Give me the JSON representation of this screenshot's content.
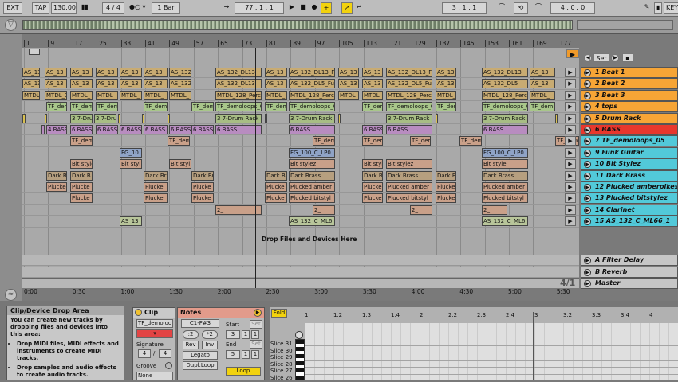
{
  "transport": {
    "ext": "EXT",
    "tap": "TAP",
    "tempo": "130.00",
    "signature": "4 / 4",
    "quantize": "1 Bar",
    "position": "77 . 1 . 1",
    "loop_start": "3 . 1 . 1",
    "loop_length": "4 . 0 . 0",
    "key": "KEY"
  },
  "ruler": {
    "bars": [
      "1",
      "9",
      "17",
      "25",
      "33",
      "41",
      "49",
      "57",
      "65",
      "73",
      "81",
      "89",
      "97",
      "105",
      "113",
      "121",
      "129",
      "137",
      "145",
      "153",
      "161",
      "169",
      "177"
    ]
  },
  "time_ruler": {
    "labels": [
      "0:00",
      "0:30",
      "1:00",
      "1:30",
      "2:00",
      "2:30",
      "3:00",
      "3:30",
      "4:00",
      "4:30",
      "5:00",
      "5:30"
    ]
  },
  "arrangement": {
    "drop_text": "Drop Files and Devices Here",
    "ratio": "4/1",
    "set_label": "Set"
  },
  "tracks": [
    {
      "name": "1 Beat 1",
      "color": "#f7a536"
    },
    {
      "name": "2 Beat 2",
      "color": "#f7a536"
    },
    {
      "name": "3 Beat 3",
      "color": "#f7a536"
    },
    {
      "name": "4 tops",
      "color": "#f7a536"
    },
    {
      "name": "5 Drum Rack",
      "color": "#f7a536"
    },
    {
      "name": "6 BASS",
      "color": "#e8372d"
    },
    {
      "name": "7 TF_demoloops_05",
      "color": "#52c9d9"
    },
    {
      "name": "9 Funk Guitar",
      "color": "#52c9d9"
    },
    {
      "name": "10 Bit Stylez",
      "color": "#52c9d9"
    },
    {
      "name": "11 Dark Brass",
      "color": "#52c9d9"
    },
    {
      "name": "12 Plucked amberpikes",
      "color": "#52c9d9"
    },
    {
      "name": "13 Plucked bitstylez",
      "color": "#52c9d9"
    },
    {
      "name": "14 Clarinet",
      "color": "#52c9d9"
    },
    {
      "name": "15 AS_132_C_ML66_1",
      "color": "#52c9d9"
    }
  ],
  "return_tracks": [
    {
      "name": "A Filter Delay"
    },
    {
      "name": "B Reverb"
    },
    {
      "name": "Master"
    }
  ],
  "clip_rows": [
    [
      [
        "AS_13",
        0,
        22
      ],
      [
        "AS_13",
        28,
        28
      ],
      [
        "AS_13",
        60,
        28
      ],
      [
        "AS_13",
        92,
        28
      ],
      [
        "AS_13",
        122,
        28
      ],
      [
        "AS_13",
        152,
        30
      ],
      [
        "AS_132",
        184,
        28
      ],
      [
        "AS_132_DL13",
        242,
        58
      ],
      [
        "AS_13",
        304,
        28
      ],
      [
        "AS_132_DL13_Fu",
        334,
        58
      ],
      [
        "AS_13",
        396,
        26
      ],
      [
        "AS_13",
        426,
        26
      ],
      [
        "AS_132_DL13_Fu",
        456,
        58
      ],
      [
        "AS_13",
        518,
        26
      ],
      [
        "AS_132_DL13",
        576,
        58
      ],
      [
        "AS_13",
        636,
        32
      ]
    ],
    [
      [
        "AS_13",
        0,
        22
      ],
      [
        "AS_13",
        28,
        28
      ],
      [
        "AS_13",
        60,
        28
      ],
      [
        "AS_13",
        92,
        28
      ],
      [
        "AS_13",
        122,
        28
      ],
      [
        "AS_13",
        152,
        30
      ],
      [
        "AS_132",
        184,
        28
      ],
      [
        "AS_132_DL13",
        242,
        58
      ],
      [
        "AS_13",
        304,
        28
      ],
      [
        "AS_132_DL5_Fu",
        334,
        58
      ],
      [
        "AS_13",
        396,
        26
      ],
      [
        "AS_13",
        426,
        26
      ],
      [
        "AS_132_DL5_Fu",
        456,
        58
      ],
      [
        "AS_13",
        518,
        26
      ],
      [
        "AS_132_DL5",
        576,
        58
      ],
      [
        "AS_13",
        636,
        32
      ]
    ],
    [
      [
        "MTDL",
        0,
        22
      ],
      [
        "MTDL_1",
        28,
        28
      ],
      [
        "MTDL_",
        60,
        28
      ],
      [
        "MTDL",
        92,
        28
      ],
      [
        "MTDL_",
        122,
        28
      ],
      [
        "MTDL_",
        152,
        30
      ],
      [
        "MTDL_",
        184,
        28
      ],
      [
        "MTDL_128_Perc",
        242,
        58
      ],
      [
        "MTDL_",
        304,
        28
      ],
      [
        "MTDL_128_Perc",
        334,
        58
      ],
      [
        "MTDL",
        396,
        26
      ],
      [
        "MTDL",
        426,
        26
      ],
      [
        "MTDL_128_Perc",
        456,
        58
      ],
      [
        "MTDL_",
        518,
        26
      ],
      [
        "MTDL_128_Perc",
        576,
        58
      ],
      [
        "MTDL_",
        636,
        32
      ]
    ],
    [
      [
        "TF_dem",
        30,
        26
      ],
      [
        "TF_dem",
        60,
        28
      ],
      [
        "TF_dem",
        92,
        28
      ],
      [
        "TF_dem",
        152,
        30
      ],
      [
        "TF_dem",
        212,
        28
      ],
      [
        "TF_demoloops_0",
        242,
        58
      ],
      [
        "TF_dem",
        304,
        28
      ],
      [
        "TF_demoloops_0",
        334,
        58
      ],
      [
        "TF_dem",
        426,
        26
      ],
      [
        "TF_demoloops_0",
        456,
        58
      ],
      [
        "TF_dem",
        518,
        26
      ],
      [
        "TF_demoloops_0",
        576,
        58
      ],
      [
        "TF_dem",
        636,
        32
      ]
    ],
    [
      [
        "",
        0,
        4
      ],
      [
        "",
        28,
        2
      ],
      [
        "3 7-Drum",
        60,
        28
      ],
      [
        "3 7-Drum",
        90,
        28
      ],
      [
        "",
        120,
        2
      ],
      [
        "",
        150,
        2
      ],
      [
        "",
        182,
        2
      ],
      [
        "3 7-Drum Rack",
        242,
        58
      ],
      [
        "",
        304,
        2
      ],
      [
        "3 7-Drum Rack",
        334,
        58
      ],
      [
        "",
        396,
        2
      ],
      [
        "3 7-Drum Rack",
        456,
        58
      ],
      [
        "",
        518,
        2
      ],
      [
        "3 7-Drum Rack",
        576,
        58
      ],
      [
        "",
        668,
        2
      ]
    ],
    [
      [
        "",
        24,
        4
      ],
      [
        "4 BASS",
        30,
        26
      ],
      [
        "6 BASS",
        60,
        28
      ],
      [
        "6 BASS",
        92,
        28
      ],
      [
        "6 BASS",
        122,
        28
      ],
      [
        "6 BASS",
        152,
        30
      ],
      [
        "6 BASS",
        184,
        28
      ],
      [
        "6 BASS",
        212,
        28
      ],
      [
        "6 BASS",
        242,
        58
      ],
      [
        "6 BASS",
        334,
        58
      ],
      [
        "6 BASS",
        426,
        26
      ],
      [
        "6 BASS",
        456,
        58
      ],
      [
        "6 BASS",
        576,
        58
      ]
    ],
    [
      [
        "TF_dem",
        60,
        28
      ],
      [
        "TF_dem",
        182,
        28
      ],
      [
        "TF_dem",
        364,
        28
      ],
      [
        "TF_dem",
        426,
        26
      ],
      [
        "TF_dem",
        486,
        26
      ],
      [
        "TF_dem",
        548,
        28
      ],
      [
        "TF_dem",
        668,
        30
      ]
    ],
    [
      [
        "FG_10",
        122,
        28
      ],
      [
        "FG_100_C_LP0",
        334,
        58
      ],
      [
        "FG_100_C_LP0",
        576,
        58
      ]
    ],
    [
      [
        "Bit style",
        60,
        28
      ],
      [
        "Bit styl",
        122,
        28
      ],
      [
        "Bit styl",
        184,
        28
      ],
      [
        "Bit stylez",
        334,
        58
      ],
      [
        "Bit styl",
        426,
        26
      ],
      [
        "Bit stylez",
        456,
        58
      ],
      [
        "Bit style",
        576,
        58
      ]
    ],
    [
      [
        "Dark B",
        30,
        26
      ],
      [
        "Dark B",
        60,
        28
      ],
      [
        "Dark Br",
        152,
        30
      ],
      [
        "Dark Br",
        212,
        28
      ],
      [
        "Dark Br",
        304,
        28
      ],
      [
        "Dark Brass",
        334,
        58
      ],
      [
        "Dark Br",
        426,
        26
      ],
      [
        "Dark Brass",
        456,
        58
      ],
      [
        "Dark Br",
        518,
        26
      ],
      [
        "Dark Brass",
        576,
        58
      ]
    ],
    [
      [
        "Plucked",
        30,
        26
      ],
      [
        "Plucke",
        60,
        28
      ],
      [
        "Plucke",
        152,
        30
      ],
      [
        "Plucke",
        212,
        28
      ],
      [
        "Plucke",
        304,
        28
      ],
      [
        "Plucked amber",
        334,
        58
      ],
      [
        "Plucke",
        426,
        26
      ],
      [
        "Plucked amber",
        456,
        58
      ],
      [
        "Plucke",
        518,
        26
      ],
      [
        "Plucked amber",
        576,
        58
      ]
    ],
    [
      [
        "Plucke",
        60,
        28
      ],
      [
        "Plucke",
        152,
        30
      ],
      [
        "Plucke",
        212,
        28
      ],
      [
        "Plucke",
        304,
        28
      ],
      [
        "Plucked bitstyl",
        334,
        58
      ],
      [
        "Plucke",
        426,
        26
      ],
      [
        "Plucked bitstyl",
        456,
        58
      ],
      [
        "Plucke",
        518,
        26
      ],
      [
        "Plucked bitstyl",
        576,
        58
      ]
    ],
    [
      [
        "2_",
        242,
        58
      ],
      [
        "2_",
        364,
        28
      ],
      [
        "2_",
        486,
        28
      ],
      [
        "2_",
        576,
        32
      ]
    ],
    [
      [
        "AS_13",
        122,
        28
      ],
      [
        "AS_132_C_ML6",
        334,
        58
      ],
      [
        "AS_132_C_ML6",
        576,
        58
      ]
    ]
  ],
  "info_panel": {
    "title": "Clip/Device Drop Area",
    "intro": "You can create new tracks by dropping files and devices into this area:",
    "bullet1": "Drop MIDI files, MIDI effects and instruments to create MIDI tracks.",
    "bullet2": "Drop samples and audio effects to create audio tracks."
  },
  "clip_panel": {
    "title": "Clip",
    "name": "TF_demoloo",
    "signature_label": "Signature",
    "sig_num": "4",
    "sig_den": "4",
    "groove_label": "Groove",
    "groove_value": "None"
  },
  "notes_panel": {
    "title": "Notes",
    "range": "C1-F#3",
    "start_label": "Start",
    "set_label": "Set",
    "halve": ":2",
    "double": "*2",
    "start_val": "3",
    "start_val2": "1",
    "start_val3": "1",
    "rev": "Rev",
    "inv": "Inv",
    "end_label": "End",
    "end_val": "5",
    "end_val2": "1",
    "end_val3": "1",
    "legato": "Legato",
    "dupl_loop": "Dupl.Loop",
    "loop": "Loop"
  },
  "editor": {
    "fold": "Fold",
    "bars": [
      "1",
      "1.2",
      "1.3",
      "1.4",
      "2",
      "2.2",
      "2.3",
      "2.4",
      "3",
      "3.2",
      "3.3",
      "3.4",
      "4",
      "4.2"
    ],
    "slices": [
      "Slice 31",
      "Slice 30",
      "Slice 29",
      "Slice 28",
      "Slice 27",
      "Slice 26"
    ]
  }
}
